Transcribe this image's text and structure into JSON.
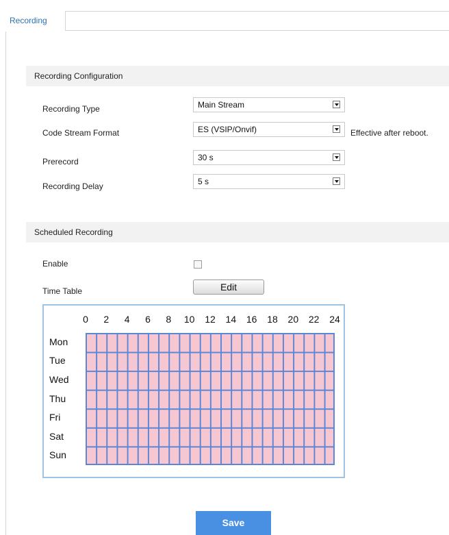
{
  "tabs": [
    {
      "label": "Recording"
    }
  ],
  "recording_config": {
    "title": "Recording Configuration",
    "fields": [
      {
        "label": "Recording Type",
        "value": "Main Stream",
        "note": ""
      },
      {
        "label": "Code Stream Format",
        "value": "ES (VSIP/Onvif)",
        "note": "Effective after reboot."
      },
      {
        "label": "Prerecord",
        "value": "30 s",
        "note": ""
      },
      {
        "label": "Recording Delay",
        "value": "5 s",
        "note": ""
      }
    ]
  },
  "scheduled_recording": {
    "title": "Scheduled Recording",
    "enable_label": "Enable",
    "enable_checked": false,
    "time_table_label": "Time Table",
    "edit_label": "Edit"
  },
  "time_table": {
    "hours": [
      "0",
      "2",
      "4",
      "6",
      "8",
      "10",
      "12",
      "14",
      "16",
      "18",
      "20",
      "22",
      "24"
    ],
    "days": [
      "Mon",
      "Tue",
      "Wed",
      "Thu",
      "Fri",
      "Sat",
      "Sun"
    ],
    "scheduled_color": "#f7c7d1",
    "grid_color": "#5b86d6"
  },
  "save_label": "Save",
  "colors": {
    "tab_text": "#2f6fb3",
    "section_bg": "#f2f2f2",
    "save_bg": "#4a90e2"
  }
}
